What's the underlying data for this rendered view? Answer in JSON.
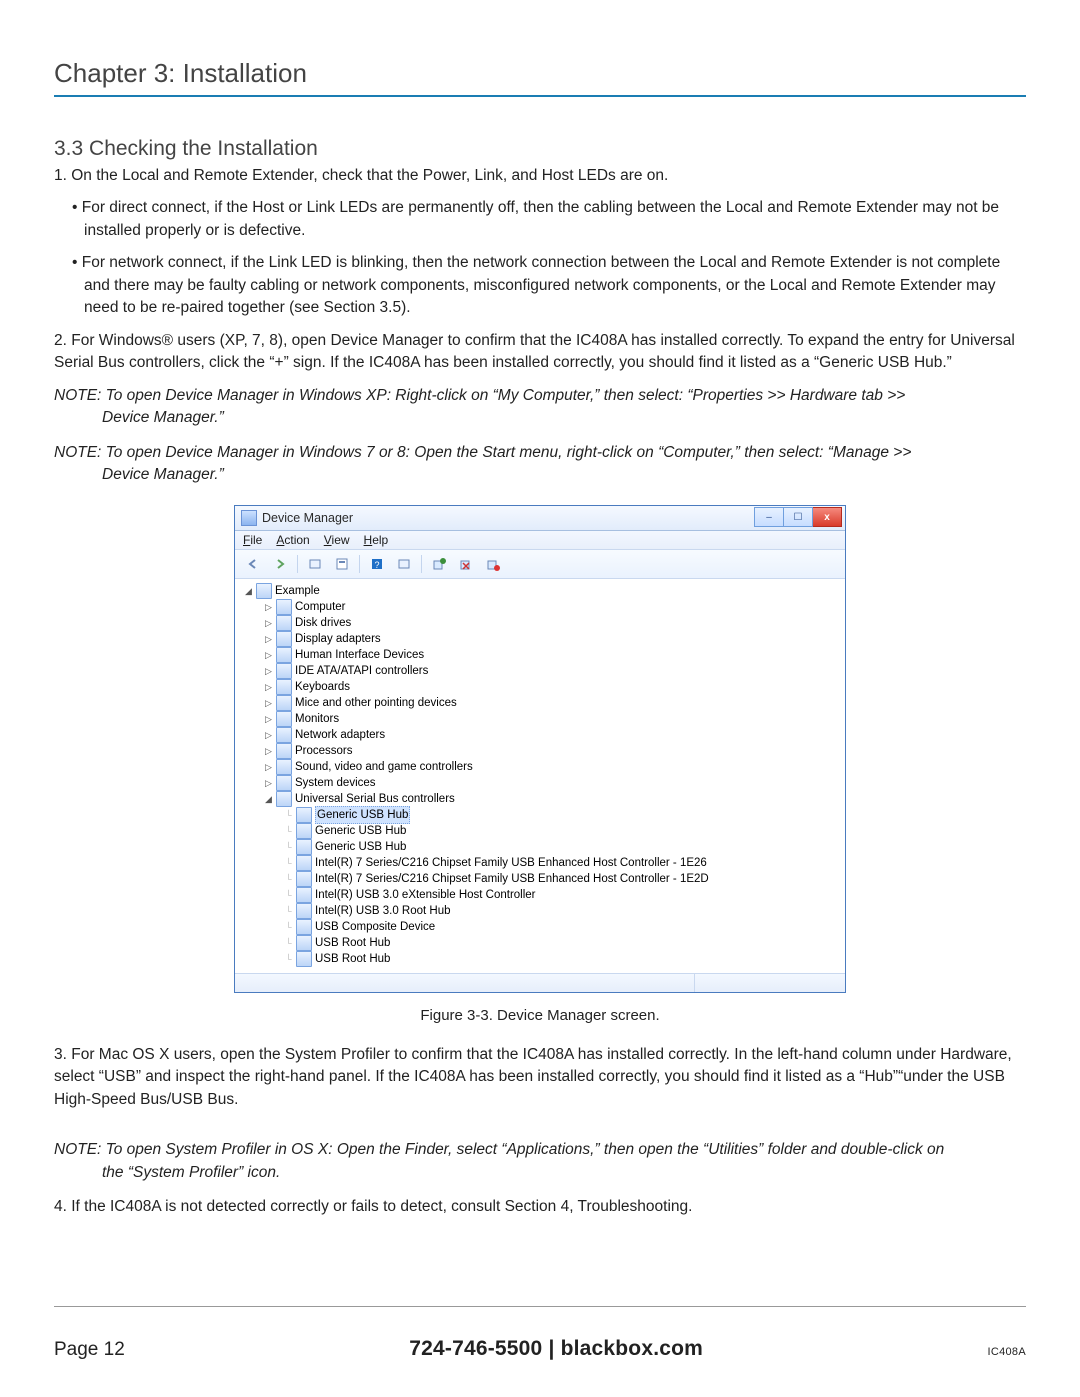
{
  "doc": {
    "chapter_title": "Chapter 3: Installation",
    "section_title": "3.3 Checking the Installation",
    "p1": "1. On the Local and Remote Extender, check that the Power, Link, and Host LEDs are on.",
    "b1": "For direct connect, if the Host or Link LEDs are permanently off, then the cabling between the Local and Remote Extender may not be installed properly or is defective.",
    "b2": "For network connect, if the Link LED is blinking, then the network connection between the Local and Remote Extender is not complete and there may be faulty cabling or network components, misconfigured network components, or the Local and Remote Extender may need to be re-paired together (see Section 3.5).",
    "p2": "2. For Windows® users (XP, 7, 8), open Device Manager to confirm that the IC408A has installed correctly. To expand the entry for Universal Serial Bus controllers, click the “+” sign. If the IC408A has been installed correctly, you should find it listed as a “Generic USB Hub.”",
    "note1_lead": "NOTE: To open Device Manager in Windows XP:  Right-click on “My Computer,” then select: “Properties >> Hardware tab >>",
    "note1_tail": "Device Manager.”",
    "note2_lead": "NOTE: To open Device Manager in Windows 7 or 8: Open the Start menu, right-click on “Computer,” then select: “Manage >>",
    "note2_tail": "Device Manager.”",
    "figure_caption": "Figure 3-3. Device Manager screen.",
    "p3": "3. For Mac OS X users, open the System Profiler to confirm that the IC408A has installed correctly. In the left-hand column under Hardware, select “USB” and inspect the right-hand panel. If the IC408A has been installed correctly, you should find it listed as a “Hub”“under the USB High-Speed Bus/USB Bus.",
    "note3_lead": "NOTE: To open System Profiler in OS X: Open the Finder, select “Applications,” then open the “Utilities” folder and double-click on",
    "note3_tail": "the “System Profiler” icon.",
    "p4": "4. If the IC408A is not detected correctly or fails to detect, consult Section 4, Troubleshooting."
  },
  "dm": {
    "title": "Device Manager",
    "menu": {
      "file": "File",
      "action": "Action",
      "view": "View",
      "help": "Help"
    },
    "root": "Example",
    "cats": [
      "Computer",
      "Disk drives",
      "Display adapters",
      "Human Interface Devices",
      "IDE ATA/ATAPI controllers",
      "Keyboards",
      "Mice and other pointing devices",
      "Monitors",
      "Network adapters",
      "Processors",
      "Sound, video and game controllers",
      "System devices"
    ],
    "usb_cat": "Universal Serial Bus controllers",
    "usb_children": [
      "Generic USB Hub",
      "Generic USB Hub",
      "Generic USB Hub",
      "Intel(R) 7 Series/C216 Chipset Family USB Enhanced Host Controller - 1E26",
      "Intel(R) 7 Series/C216 Chipset Family USB Enhanced Host Controller - 1E2D",
      "Intel(R) USB 3.0 eXtensible Host Controller",
      "Intel(R) USB 3.0 Root Hub",
      "USB Composite Device",
      "USB Root Hub",
      "USB Root Hub"
    ]
  },
  "footer": {
    "page_label": "Page 12",
    "center": "724-746-5500   |   blackbox.com",
    "model": "IC408A"
  }
}
